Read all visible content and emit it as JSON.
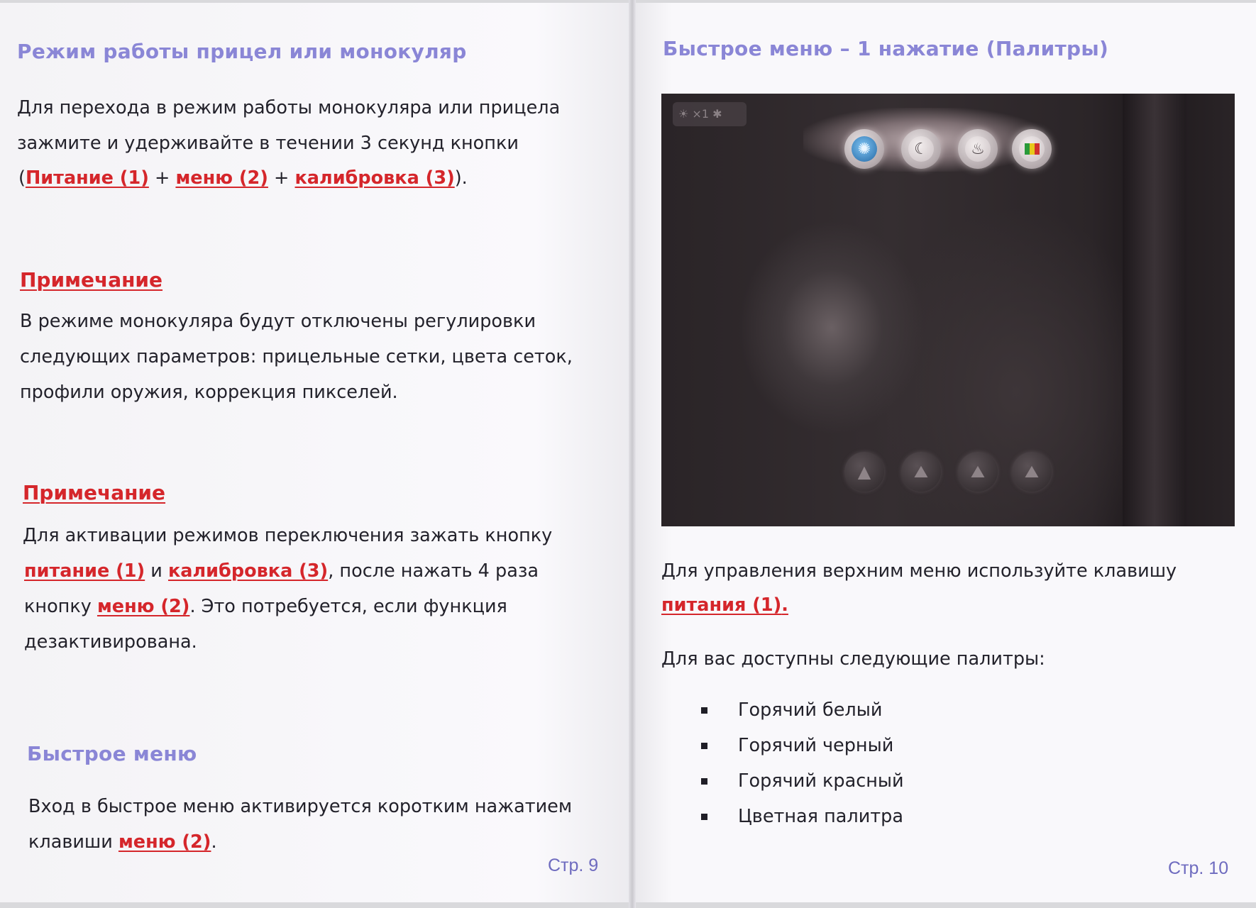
{
  "left_page": {
    "section1": {
      "title": "Режим работы прицел или монокуляр",
      "line1": "Для перехода в режим работы монокуляра или прицела",
      "line2": "зажмите и удерживайте в течении 3 секунд кнопки",
      "line3": {
        "open": "(",
        "link1": "Питание (1)",
        "sep1": " + ",
        "link2": "меню (2)",
        "sep2": " + ",
        "link3": "калибровка (3)",
        "close": ")."
      }
    },
    "note1": {
      "title": "Примечание",
      "line1": "В режиме монокуляра будут отключены регулировки",
      "line2": "следующих параметров: прицельные сетки, цвета сеток,",
      "line3": "профили оружия, коррекция пикселей."
    },
    "note2": {
      "title": "Примечание",
      "line1": "Для активации режимов переключения зажать кнопку",
      "line2": {
        "link1": "питание (1)",
        "mid": " и ",
        "link2": "калибровка (3)",
        "tail": ", после нажать 4 раза"
      },
      "line3": {
        "head": "кнопку ",
        "link": "меню (2)",
        "tail": ". Это потребуется, если функция"
      },
      "line4": "дезактивирована."
    },
    "quick_menu": {
      "title": "Быстрое меню",
      "line1": "Вход в быстрое меню активируется коротким нажатием",
      "line2": {
        "head": "клавиши ",
        "link": "меню (2)",
        "tail": "."
      }
    },
    "page_number": "Стр. 9"
  },
  "right_page": {
    "title": "Быстрое меню – 1 нажатие (Палитры)",
    "image": {
      "status_text": "☀ ×1 ✱",
      "palette_icons": [
        "sun-icon",
        "moon-icon",
        "flame-icon",
        "color-bars-icon"
      ],
      "bottom_icons": [
        "scene-icon",
        "mountain-icon-1",
        "mountain-icon-2",
        "mountain-icon-3"
      ]
    },
    "control": {
      "line1": "Для управления верхним меню используйте клавишу",
      "link": "питания (1)",
      "tail": "."
    },
    "palettes_intro": "Для вас доступны следующие палитры:",
    "palettes": [
      "Горячий белый",
      "Горячий черный",
      "Горячий красный",
      "Цветная палитра"
    ],
    "page_number": "Стр. 10"
  },
  "colors": {
    "heading_blue": "#8a86d6",
    "link_red": "#d5262b",
    "page_number": "#6e6bbf"
  }
}
